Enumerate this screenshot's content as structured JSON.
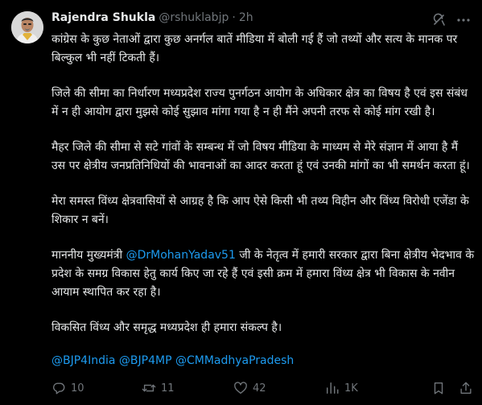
{
  "author": {
    "name": "Rajendra Shukla",
    "handle": "@rshuklabjp",
    "separator": "·",
    "time": "2h"
  },
  "tweet": {
    "paragraphs": [
      {
        "text": "कांग्रेस के कुछ नेताओं द्वारा कुछ अनर्गल बातें मीडिया में बोली गई हैं जो तथ्यों और सत्य के मानक पर बिल्कुल भी नहीं टिकती हैं।"
      },
      {
        "text": "जिले की सीमा का निर्धारण मध्यप्रदेश राज्य पुनर्गठन आयोग के अधिकार क्षेत्र का विषय है एवं इस संबंध में न ही आयोग द्वारा मुझसे कोई सुझाव मांगा गया है न ही मैंने अपनी तरफ से कोई मांग रखी है।"
      },
      {
        "text": "मैहर जिले की सीमा से सटे गांवों के सम्बन्ध में जो विषय मीडिया के माध्यम से मेरे संज्ञान में आया है मैं उस पर क्षेत्रीय जनप्रतिनिधियों की भावनाओं का आदर करता हूं एवं उनकी मांगों का भी समर्थन करता हूं।"
      },
      {
        "text": "मेरा समस्त विंध्य क्षेत्रवासियों से आग्रह है कि आप ऐसे किसी भी तथ्य विहीन और विंध्य विरोधी एजेंडा के शिकार न बनें।"
      },
      {
        "before": "माननीय मुख्यमंत्री ",
        "mention": "@DrMohanYadav51",
        "after": " जी के नेतृत्व में हमारी सरकार द्वारा बिना क्षेत्रीय भेदभाव के प्रदेश के समग्र विकास हेतु कार्य किए जा रहे हैं एवं इसी क्रम में हमारा विंध्य क्षेत्र  भी विकास के नवीन आयाम स्थापित कर रहा है।"
      },
      {
        "text": "विकसित विंध्य और समृद्ध मध्यप्रदेश ही हमारा संकल्प है।"
      }
    ],
    "hashtags": [
      "@BJP4India",
      "@BJP4MP",
      "@CMMadhyaPradesh"
    ]
  },
  "actions": {
    "replies": "10",
    "reposts": "11",
    "likes": "42",
    "views": "1K"
  },
  "icons": {
    "grok": "grok-icon",
    "more": "more-icon",
    "reply": "reply-icon",
    "repost": "repost-icon",
    "like": "like-icon",
    "views": "views-icon",
    "bookmark": "bookmark-icon",
    "share": "share-icon"
  },
  "colors": {
    "background": "#000000",
    "text": "#e7e9ea",
    "muted": "#71767b",
    "link": "#1d9bf0"
  }
}
